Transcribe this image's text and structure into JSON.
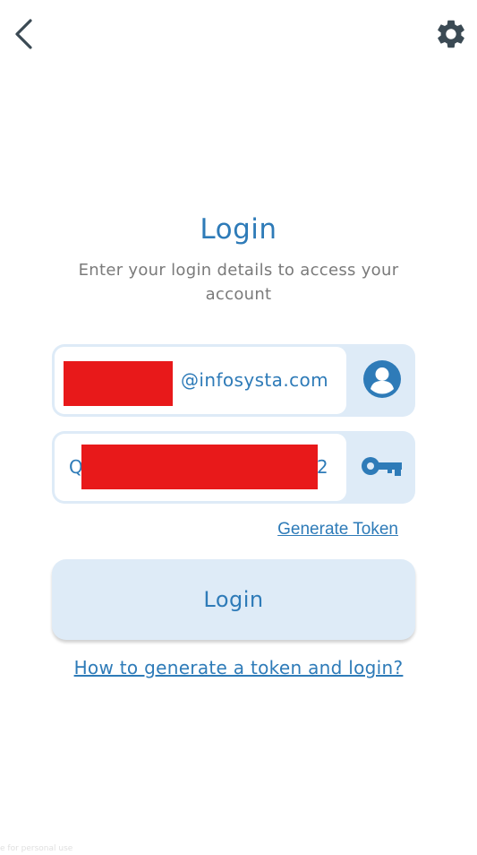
{
  "topbar": {
    "back_icon": "chevron-left-icon",
    "settings_icon": "gear-icon"
  },
  "header": {
    "title": "Login",
    "subtitle": "Enter your login details to access your account"
  },
  "email_field": {
    "value_suffix": "@infosysta.com",
    "icon": "user-circle-icon"
  },
  "token_field": {
    "value_first_char": "Q",
    "value_last_char": "2",
    "icon": "key-icon"
  },
  "links": {
    "generate_token": "Generate Token",
    "help": "How to generate a token and login?"
  },
  "login_button": {
    "label": "Login"
  },
  "footer": {
    "watermark": "e for personal use"
  },
  "colors": {
    "accent": "#2e7bb8",
    "field_bg": "#deebf7",
    "icon_dark": "#3b4a54",
    "redaction": "#e8191a"
  }
}
